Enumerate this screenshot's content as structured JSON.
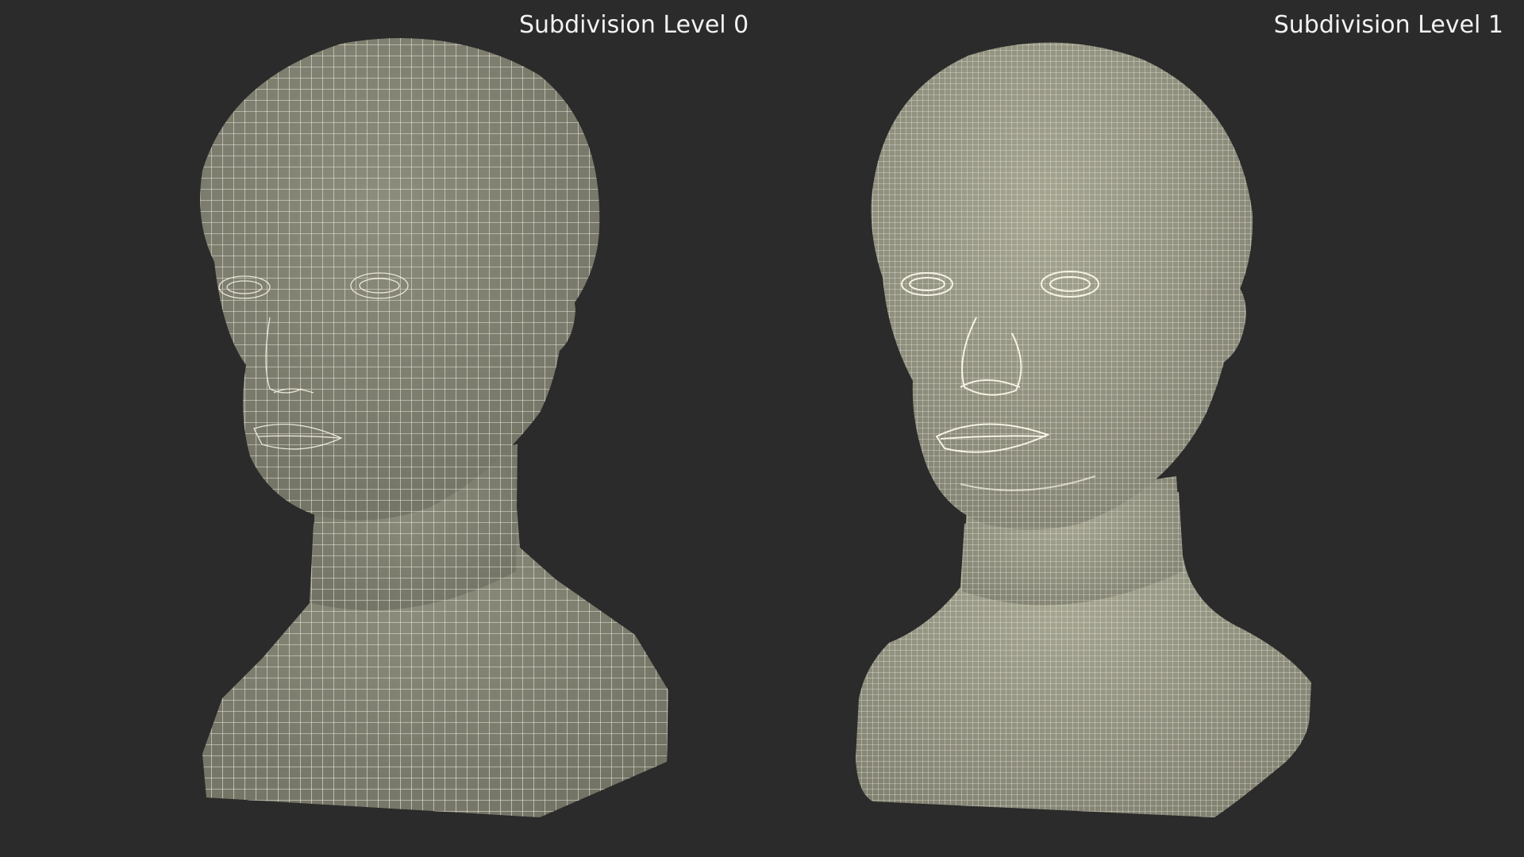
{
  "labels": {
    "left": "Subdivision Level 0",
    "right": "Subdivision Level 1"
  },
  "colors": {
    "background": "#2b2b2b",
    "mesh_fill_level0": "#8a8a7a",
    "mesh_fill_level1": "#9a9a88",
    "wire": "#f4f1e2"
  },
  "models": [
    {
      "name": "level-0",
      "grid_density": "coarse"
    },
    {
      "name": "level-1",
      "grid_density": "fine"
    }
  ]
}
